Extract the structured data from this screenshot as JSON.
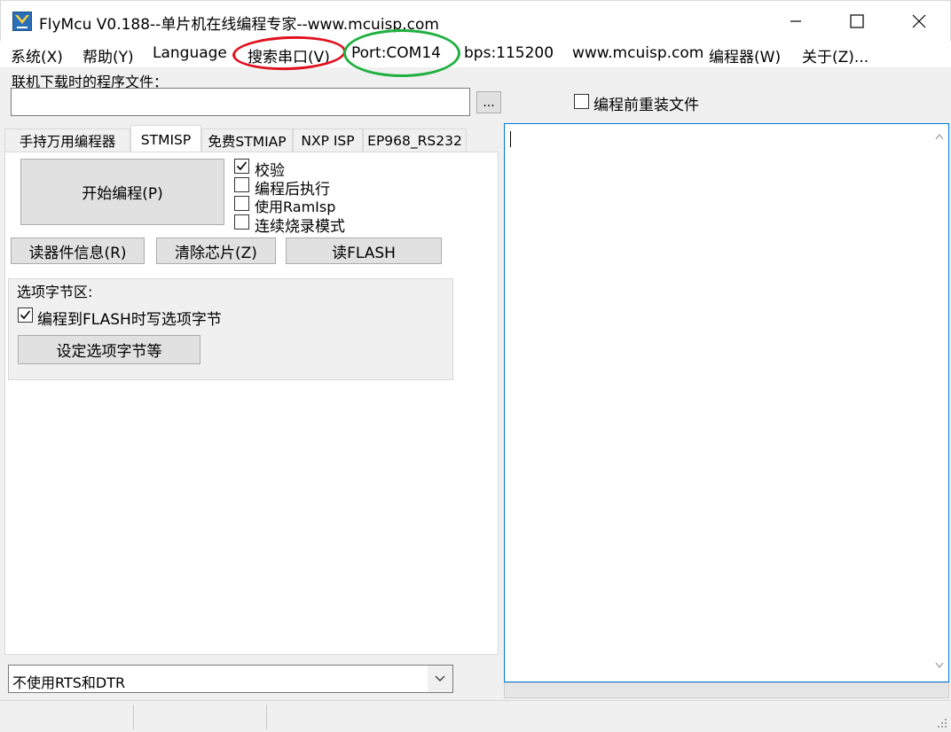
{
  "window": {
    "title": "FlyMcu V0.188--单片机在线编程专家--www.mcuisp.com",
    "minimize_symbol": "—",
    "maximize_symbol": "☐",
    "close_symbol": "✕"
  },
  "menu": {
    "system": "系统(X)",
    "help": "帮助(Y)",
    "language": "Language",
    "search_port": "搜索串口(V)",
    "port": "Port:COM14",
    "bps": "bps:115200",
    "website": "www.mcuisp.com",
    "programmer": "编程器(W)",
    "about": "关于(Z)..."
  },
  "annotations": {
    "red_oval_color": "#e0101e",
    "green_oval_color": "#20b040"
  },
  "file": {
    "label": "联机下载时的程序文件：",
    "path": "",
    "browse": "...",
    "reload_label": "编程前重装文件",
    "reload_checked": false
  },
  "tabs": [
    "手持万用编程器",
    "STMISP",
    "免费STMIAP",
    "NXP ISP",
    "EP968_RS232"
  ],
  "active_tab": "STMISP",
  "stmisp": {
    "start_program": "开始编程(P)",
    "options": [
      {
        "label": "校验",
        "checked": true
      },
      {
        "label": "编程后执行",
        "checked": false
      },
      {
        "label": "使用RamIsp",
        "checked": false
      },
      {
        "label": "连续烧录模式",
        "checked": false
      }
    ],
    "read_info": "读器件信息(R)",
    "erase_chip": "清除芯片(Z)",
    "read_flash": "读FLASH",
    "option_bytes": {
      "group_label": "选项字节区:",
      "write_label": "编程到FLASH时写选项字节",
      "write_checked": true,
      "set_button": "设定选项字节等"
    }
  },
  "rts_dtr": {
    "selected": "不使用RTS和DTR"
  },
  "log": {
    "text": ""
  }
}
